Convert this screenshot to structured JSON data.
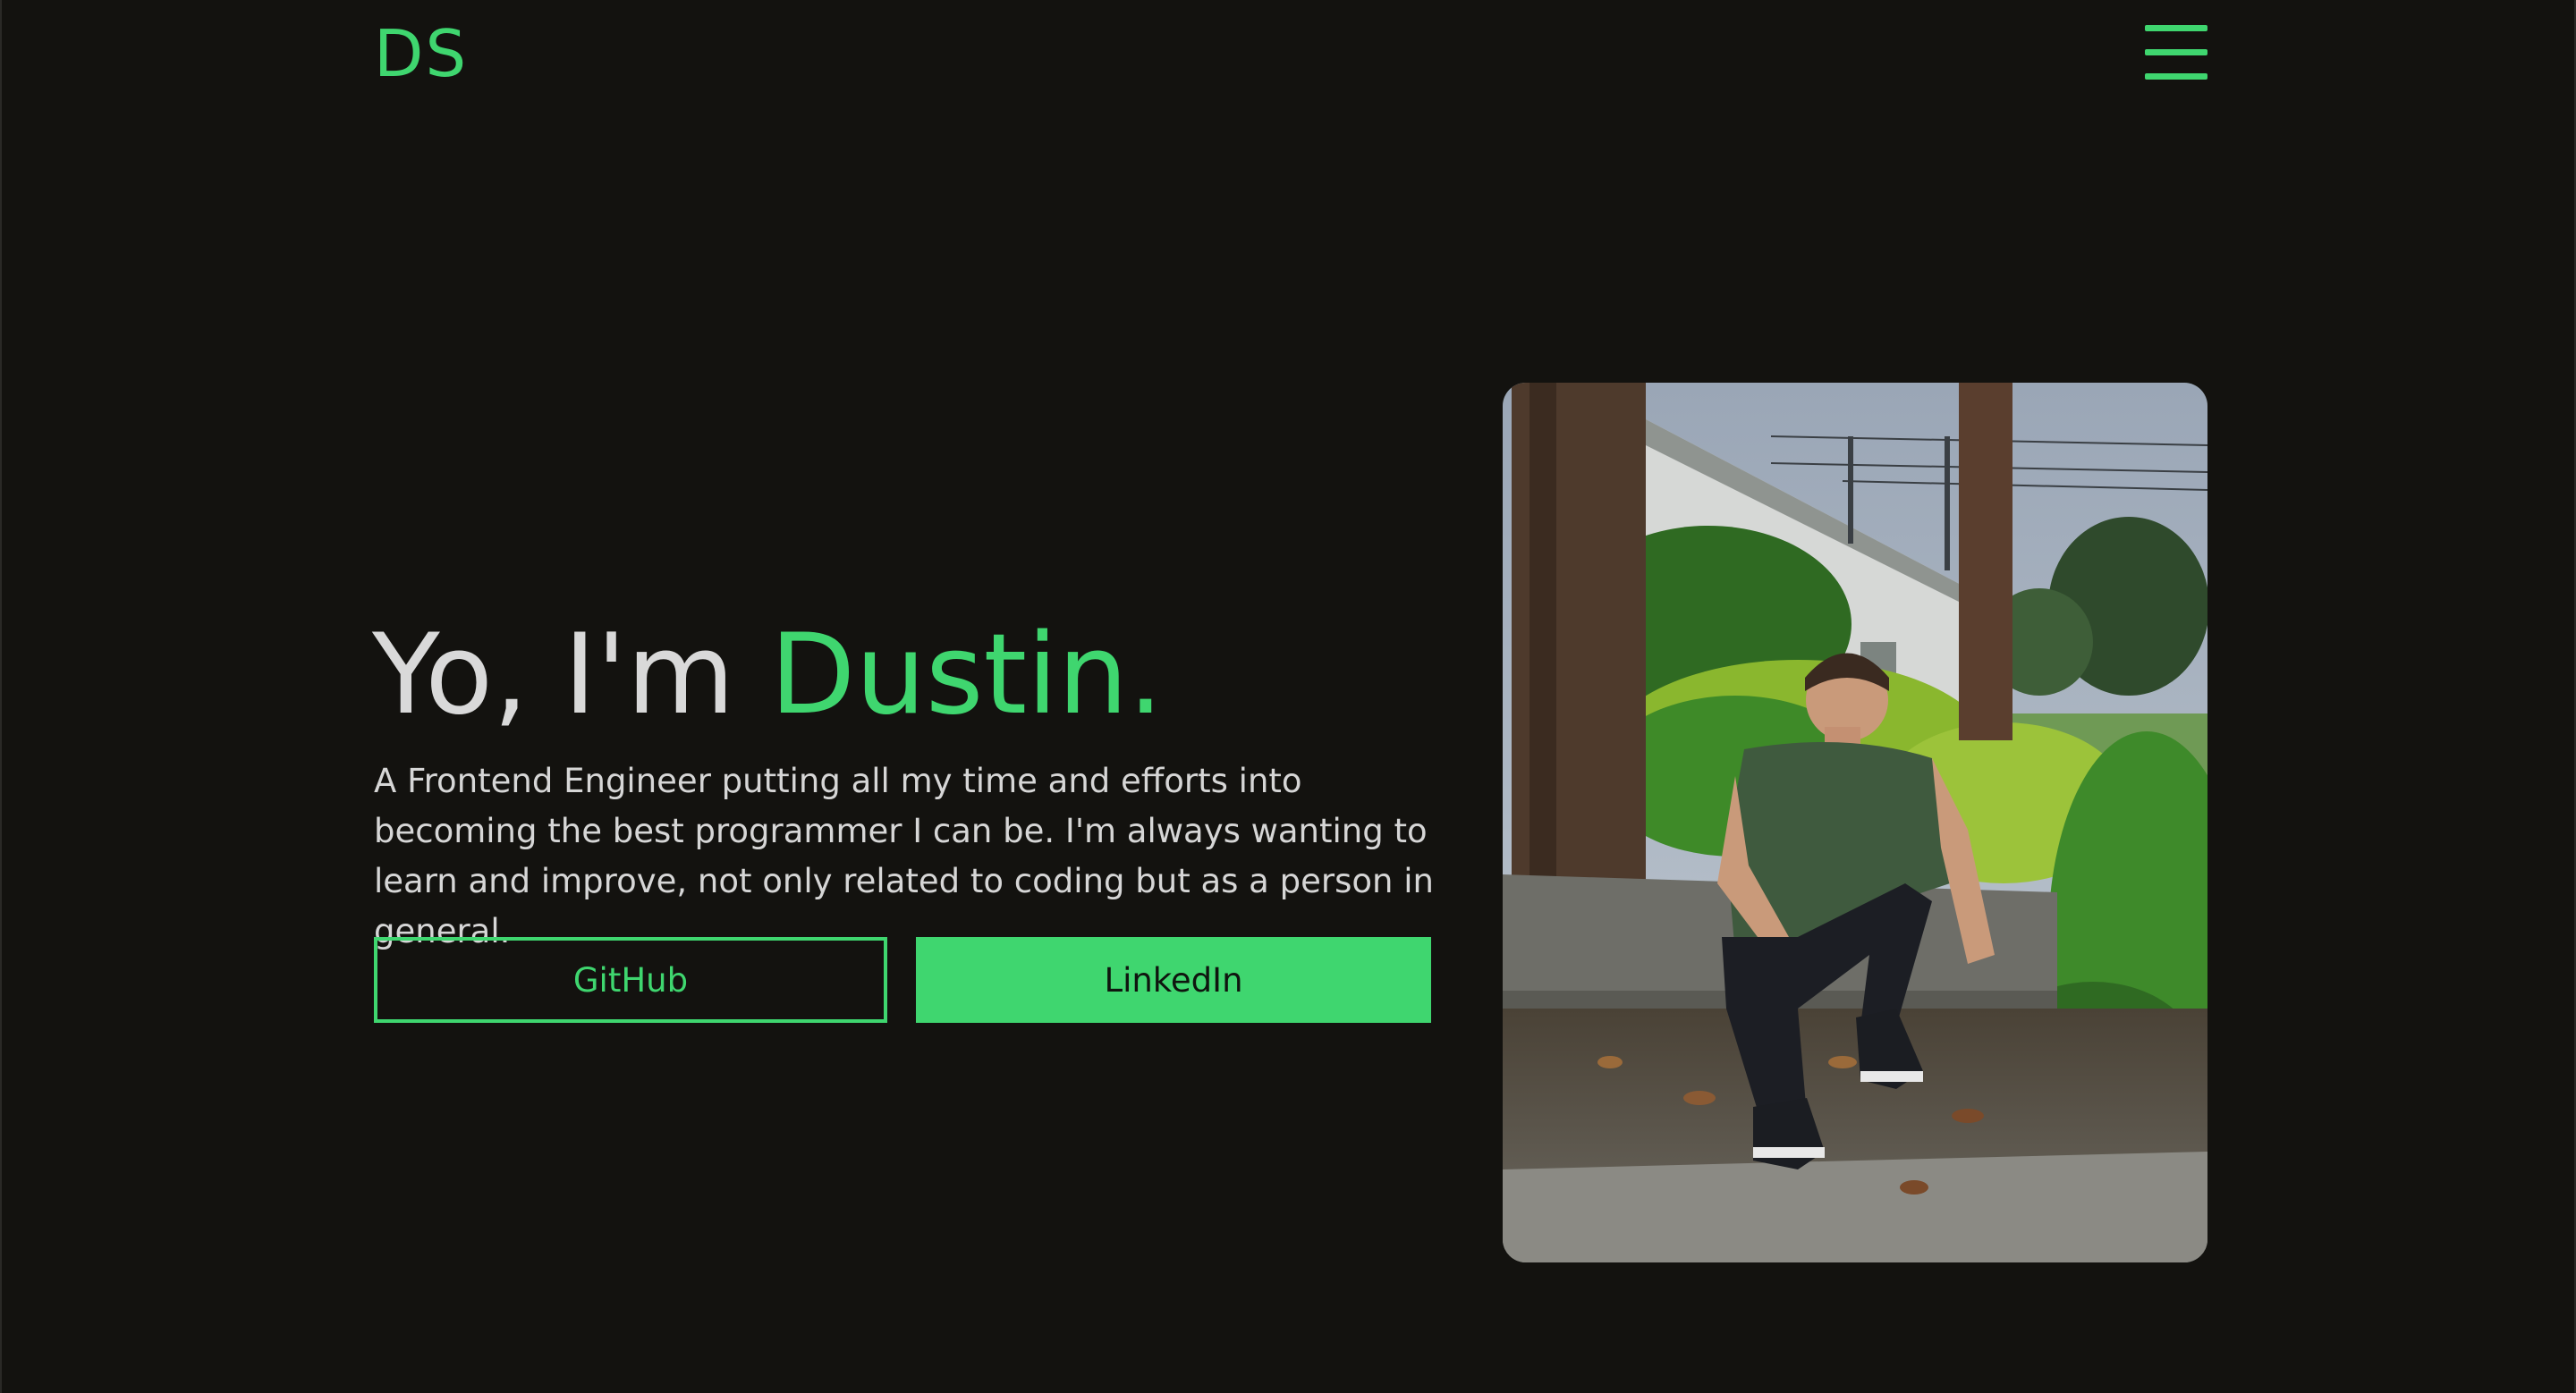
{
  "header": {
    "logo": "DS",
    "menu_icon": "hamburger-menu-icon"
  },
  "hero": {
    "greeting": "Yo, I'm ",
    "name": "Dustin.",
    "bio": "A Frontend Engineer putting all my time and efforts into becoming the best programmer I can be. I'm always wanting to learn and improve, not only related to coding but as a person in general.",
    "buttons": {
      "github": "GitHub",
      "linkedin": "LinkedIn"
    },
    "photo_alt": "Portrait photo of Dustin"
  },
  "colors": {
    "background": "#13120f",
    "accent": "#3fd66f",
    "text": "#d9d9d9"
  }
}
